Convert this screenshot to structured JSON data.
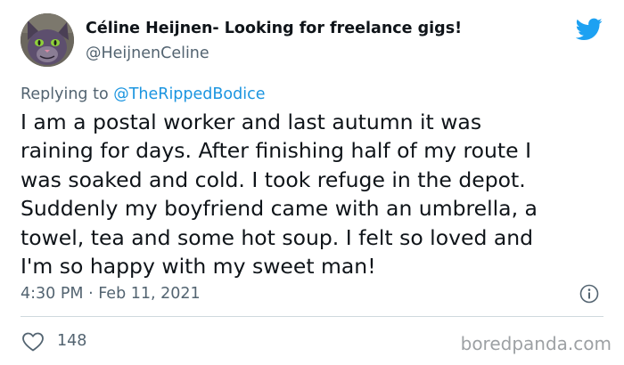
{
  "author": {
    "display_name": "Céline Heijnen- Looking for freelance gigs!",
    "handle": "@HeijnenCeline"
  },
  "reply": {
    "prefix": "Replying to ",
    "mention": "@TheRippedBodice"
  },
  "tweet": {
    "lines": [
      "I am a postal worker and last autumn it was",
      "raining for days. After finishing half of my route I",
      "was soaked and cold. I took refuge in the depot.",
      "Suddenly my boyfriend came with an umbrella, a",
      "towel, tea and some hot soup. I felt so loved and",
      "I'm so happy with my sweet man!"
    ],
    "timestamp": "4:30 PM · Feb 11, 2021"
  },
  "engagement": {
    "like_count": "148"
  },
  "watermark": "boredpanda.com",
  "icons": {
    "brand": "twitter-bird-icon",
    "info": "info-icon",
    "like": "heart-icon"
  },
  "colors": {
    "twitter_blue": "#1da1f2",
    "mention_blue": "#1b95e0",
    "text_primary": "#0f1419",
    "text_secondary": "#536471",
    "divider": "#cfd9de",
    "watermark": "#9da1a4"
  }
}
